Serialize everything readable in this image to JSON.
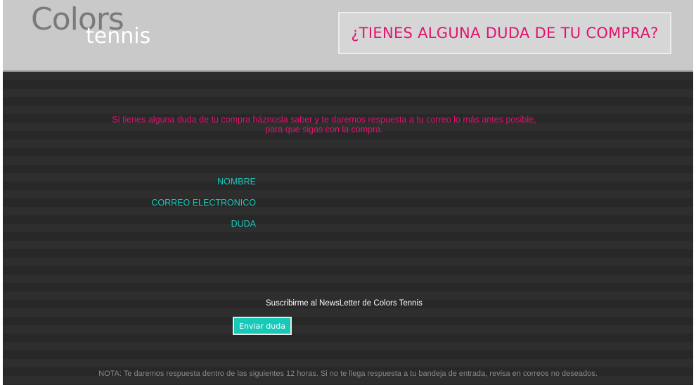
{
  "header": {
    "logo_main": "Colors",
    "logo_sub": "tennis",
    "banner": "¿TIENES ALGUNA DUDA DE TU COMPRA?"
  },
  "intro": {
    "line1": "Si tienes alguna duda de tu compra háznosla saber y te daremos respuesta a tu correo  lo más antes posible,",
    "line2": "para que sigas con la compra."
  },
  "form": {
    "name_label": "NOMBRE",
    "email_label": "CORREO ELECTRONICO",
    "question_label": "DUDA",
    "newsletter_label": "Suscribirme al NewsLetter de Colors Tennis",
    "submit_label": "Enviar duda"
  },
  "note": "NOTA: Te daremos respuesta dentro de las siguientes 12 horas. Si no te llega respuesta a tu bandeja de entrada, revisa en correos no deseados.",
  "colors": {
    "accent_pink": "#e2126f",
    "accent_teal": "#19c9b8",
    "background": "#2b2b2b",
    "header": "#c9c9c9"
  }
}
